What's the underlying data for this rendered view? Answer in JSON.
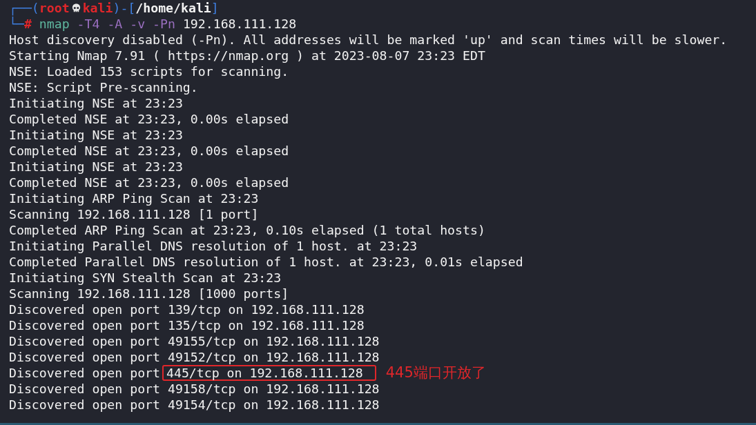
{
  "prompt": {
    "open": "┌──(",
    "user": "root",
    "host": "kali",
    "separator": ")-[",
    "path": "/home/kali",
    "close": "]",
    "corner": "└─",
    "symbol": "#",
    "command": "nmap",
    "options": "-T4 -A -v -Pn",
    "argument": "192.168.111.128"
  },
  "lines": [
    {
      "kind": "plain",
      "text": "Host discovery disabled (-Pn). All addresses will be marked 'up' and scan times will be slower."
    },
    {
      "kind": "plain",
      "text": "Starting Nmap 7.91 ( https://nmap.org ) at 2023-08-07 23:23 EDT"
    },
    {
      "kind": "plain",
      "text": "NSE: Loaded 153 scripts for scanning."
    },
    {
      "kind": "plain",
      "text": "NSE: Script Pre-scanning."
    },
    {
      "kind": "plain",
      "text": "Initiating NSE at 23:23"
    },
    {
      "kind": "plain",
      "text": "Completed NSE at 23:23, 0.00s elapsed"
    },
    {
      "kind": "plain",
      "text": "Initiating NSE at 23:23"
    },
    {
      "kind": "plain",
      "text": "Completed NSE at 23:23, 0.00s elapsed"
    },
    {
      "kind": "plain",
      "text": "Initiating NSE at 23:23"
    },
    {
      "kind": "plain",
      "text": "Completed NSE at 23:23, 0.00s elapsed"
    },
    {
      "kind": "plain",
      "text": "Initiating ARP Ping Scan at 23:23"
    },
    {
      "kind": "plain",
      "text": "Scanning 192.168.111.128 [1 port]"
    },
    {
      "kind": "plain",
      "text": "Completed ARP Ping Scan at 23:23, 0.10s elapsed (1 total hosts)"
    },
    {
      "kind": "plain",
      "text": "Initiating Parallel DNS resolution of 1 host. at 23:23"
    },
    {
      "kind": "plain",
      "text": "Completed Parallel DNS resolution of 1 host. at 23:23, 0.01s elapsed"
    },
    {
      "kind": "plain",
      "text": "Initiating SYN Stealth Scan at 23:23"
    },
    {
      "kind": "plain",
      "text": "Scanning 192.168.111.128 [1000 ports]"
    },
    {
      "kind": "plain",
      "text": "Discovered open port 139/tcp on 192.168.111.128"
    },
    {
      "kind": "plain",
      "text": "Discovered open port 135/tcp on 192.168.111.128"
    },
    {
      "kind": "plain",
      "text": "Discovered open port 49155/tcp on 192.168.111.128"
    },
    {
      "kind": "plain",
      "text": "Discovered open port 49152/tcp on 192.168.111.128"
    },
    {
      "kind": "boxed",
      "text": "Discovered open port",
      "boxed": "445/tcp on 192.168.111.128",
      "note": "445端口开放了"
    },
    {
      "kind": "plain",
      "text": "Discovered open port 49158/tcp on 192.168.111.128"
    },
    {
      "kind": "plain",
      "text": "Discovered open port 49154/tcp on 192.168.111.128"
    }
  ]
}
